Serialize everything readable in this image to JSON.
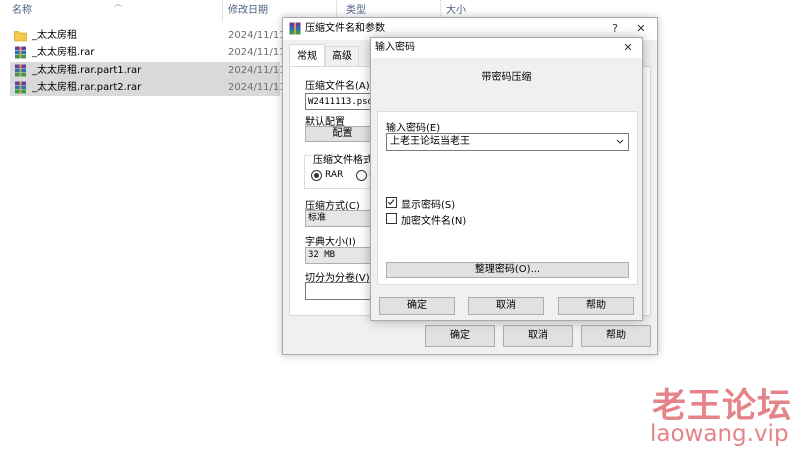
{
  "explorer": {
    "columns": {
      "name": "名称",
      "modified": "修改日期",
      "type": "类型",
      "size": "大小"
    },
    "files": [
      {
        "name": "_太太房租",
        "date": "2024/11/11",
        "icon": "folder-icon",
        "selected": false
      },
      {
        "name": "_太太房租.rar",
        "date": "2024/11/11",
        "icon": "rar-archive-icon",
        "selected": false
      },
      {
        "name": "_太太房租.rar.part1.rar",
        "date": "2024/11/11",
        "icon": "rar-archive-icon",
        "selected": true
      },
      {
        "name": "_太太房租.rar.part2.rar",
        "date": "2024/11/11",
        "icon": "rar-archive-icon",
        "selected": true
      }
    ]
  },
  "archive_dialog": {
    "title": "压缩文件名和参数",
    "help_glyph": "?",
    "close_glyph": "✕",
    "tabs": [
      "常规",
      "高级"
    ],
    "archive_name_label": "压缩文件名(A)",
    "archive_name_value": "W2411113.psd",
    "default_profile_label": "默认配置",
    "profile_button": "配置",
    "format_group_label": "压缩文件格式",
    "format_rar": "RAR",
    "format_second_fragment": "R",
    "method_label": "压缩方式(C)",
    "method_value": "标准",
    "dict_label": "字典大小(I)",
    "dict_value": "32 MB",
    "split_label": "切分为分卷(V)",
    "ok_button": "确定",
    "cancel_button": "取消",
    "help_button": "帮助"
  },
  "password_dialog": {
    "title": "输入密码",
    "close_glyph": "✕",
    "header": "带密码压缩",
    "password_label": "输入密码(E)",
    "password_value": "上老王论坛当老王",
    "show_password_label": "显示密码(S)",
    "show_password_checked": true,
    "encrypt_names_label": "加密文件名(N)",
    "encrypt_names_checked": false,
    "organize_button": "整理密码(O)...",
    "ok_button": "确定",
    "cancel_button": "取消",
    "help_button": "帮助"
  },
  "watermark": {
    "title": "老王论坛",
    "url": "laowang.vip"
  },
  "colors": {
    "selection": "#d9d9d9",
    "watermark": "#e16e73",
    "dialog_bg": "#f0f0f0"
  }
}
